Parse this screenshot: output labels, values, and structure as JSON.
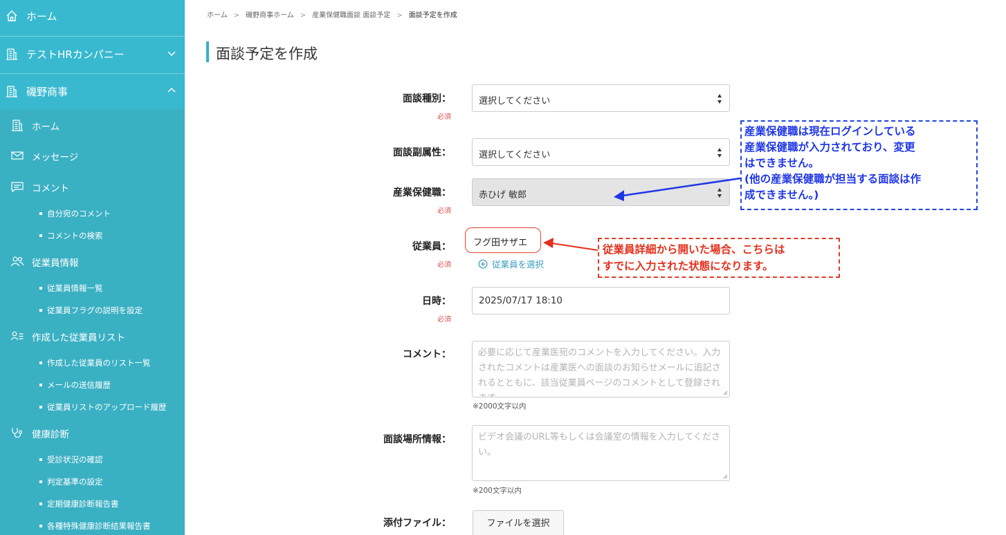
{
  "sidebar": {
    "top_items": [
      {
        "label": "ホーム",
        "icon": "home-icon"
      },
      {
        "label": "テストHRカンパニー",
        "icon": "building-icon",
        "chevron": "chevron-down-icon"
      },
      {
        "label": "磯野商事",
        "icon": "building-icon",
        "chevron": "chevron-up-icon"
      }
    ],
    "sub_items": [
      {
        "label": "ホーム",
        "icon": "building-icon"
      },
      {
        "label": "メッセージ",
        "icon": "envelope-icon"
      },
      {
        "label": "コメント",
        "icon": "comment-icon",
        "children": [
          "自分宛のコメント",
          "コメントの検索"
        ]
      },
      {
        "label": "従業員情報",
        "icon": "users-icon",
        "children": [
          "従業員情報一覧",
          "従業員フラグの説明を設定"
        ]
      },
      {
        "label": "作成した従業員リスト",
        "icon": "user-list-icon",
        "children": [
          "作成した従業員のリスト一覧",
          "メールの送信履歴",
          "従業員リストのアップロード履歴"
        ]
      },
      {
        "label": "健康診断",
        "icon": "stethoscope-icon",
        "children": [
          "受診状況の確認",
          "判定基準の設定",
          "定期健康診断報告書",
          "各種特殊健康診断結果報告書"
        ]
      }
    ]
  },
  "breadcrumb": [
    "ホーム",
    "磯野商事ホーム",
    "産業保健職面談 面談予定",
    "面談予定を作成"
  ],
  "breadcrumb_separator": ">",
  "page_title": "面談予定を作成",
  "form": {
    "required_label": "必須",
    "interview_type": {
      "label": "面談種別：",
      "value": "選択してください"
    },
    "interview_subattr": {
      "label": "面談副属性：",
      "value": "選択してください"
    },
    "health_staff": {
      "label": "産業保健職：",
      "value": "赤ひげ 敏郎"
    },
    "employee": {
      "label": "従業員：",
      "value": "フグ田サザエ",
      "select_link": "従業員を選択"
    },
    "datetime": {
      "label": "日時：",
      "value": "2025/07/17 18:10"
    },
    "comment": {
      "label": "コメント：",
      "placeholder": "必要に応じて産業医宛のコメントを入力してください。入力されたコメントは産業医への面談のお知らせメールに追記されるとともに、該当従業員ページのコメントとして登録されます。",
      "hint": "※2000文字以内"
    },
    "location": {
      "label": "面談場所情報：",
      "placeholder": "ビデオ会議のURL等もしくは会議室の情報を入力してください。",
      "hint": "※200文字以内"
    },
    "attachment": {
      "label": "添付ファイル：",
      "button": "ファイルを選択"
    }
  },
  "callouts": {
    "blue_lines": [
      "産業保健職は現在ログインしている",
      "産業保健職が入力されており、変更",
      "はできません。",
      "(他の産業保健職が担当する面談は作",
      "成できません。)"
    ],
    "red_lines": [
      "従業員詳細から開いた場合、こちらは",
      "すでに入力された状態になります。"
    ]
  },
  "colors": {
    "sidebar": "#38b9cf",
    "accent": "#3ab0c3",
    "required": "#d9534f",
    "callout_blue": "#1f36e6",
    "callout_red": "#e3301c"
  }
}
